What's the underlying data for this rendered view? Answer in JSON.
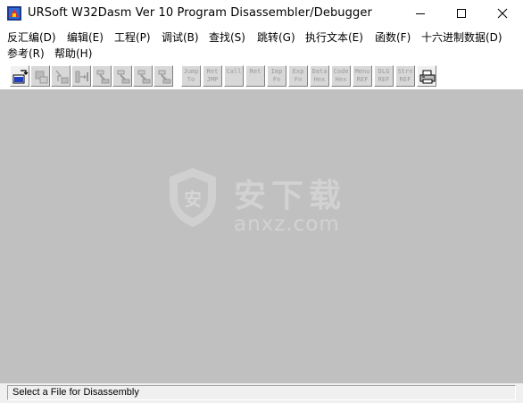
{
  "window": {
    "title": "URSoft W32Dasm Ver 10   Program Disassembler/Debugger"
  },
  "menu": [
    {
      "label": "反汇编(D)"
    },
    {
      "label": "编辑(E)"
    },
    {
      "label": "工程(P)"
    },
    {
      "label": "调试(B)"
    },
    {
      "label": "查找(S)"
    },
    {
      "label": "跳转(G)"
    },
    {
      "label": "执行文本(E)"
    },
    {
      "label": "函数(F)"
    },
    {
      "label": "十六进制数据(D)"
    },
    {
      "label": "参考(R)"
    },
    {
      "label": "帮助(H)"
    }
  ],
  "toolbar": {
    "buttons": [
      {
        "name": "open-file",
        "icon": "open-file-icon"
      },
      {
        "name": "save",
        "icon": "save-icon"
      },
      {
        "name": "load-process",
        "icon": "load-process-icon"
      },
      {
        "name": "step-into",
        "icon": "step-icon"
      },
      {
        "name": "goto-code-start",
        "icon": "goto-icon"
      },
      {
        "name": "goto-program-entry",
        "icon": "goto-icon"
      },
      {
        "name": "goto-page",
        "icon": "goto-icon"
      },
      {
        "name": "goto-code-location",
        "icon": "goto-icon"
      },
      {
        "name": "jump-to",
        "line1": "Jump",
        "line2": "To"
      },
      {
        "name": "ret-jmp",
        "line1": "Ret",
        "line2": "JMP"
      },
      {
        "name": "call",
        "line1": "Call",
        "line2": ""
      },
      {
        "name": "ret",
        "line1": "Ret",
        "line2": ""
      },
      {
        "name": "imp-fn",
        "line1": "Imp",
        "line2": "Fn"
      },
      {
        "name": "exp-fn",
        "line1": "Exp",
        "line2": "Fn"
      },
      {
        "name": "data-hex",
        "line1": "Data",
        "line2": "Hex"
      },
      {
        "name": "code-hex",
        "line1": "Code",
        "line2": "Hex"
      },
      {
        "name": "menu-ref",
        "line1": "Menu",
        "line2": "REF"
      },
      {
        "name": "dlg-ref",
        "line1": "DLG",
        "line2": "REF"
      },
      {
        "name": "strn-ref",
        "line1": "Strn",
        "line2": "REF"
      },
      {
        "name": "print",
        "icon": "printer-icon"
      }
    ]
  },
  "watermark": {
    "cn": "安下载",
    "domain": "anxz.com"
  },
  "status": {
    "text": "Select a File for Disassembly"
  }
}
